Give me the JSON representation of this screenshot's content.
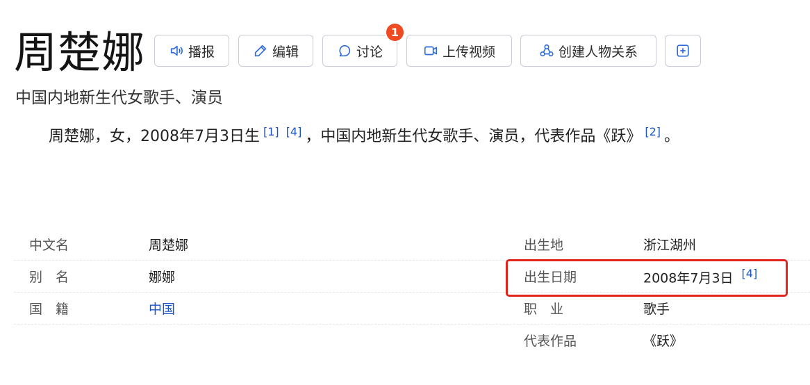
{
  "page": {
    "title": "周楚娜",
    "subtitle": "中国内地新生代女歌手、演员"
  },
  "toolbar": {
    "report_label": "播报",
    "edit_label": "编辑",
    "discuss_label": "讨论",
    "discuss_badge": "1",
    "upload_video_label": "上传视频",
    "relation_label": "创建人物关系"
  },
  "summary": {
    "text_1": "周楚娜，女，2008年7月3日生",
    "ref_1": "[1]",
    "ref_2": "[4]",
    "text_2": "，中国内地新生代女歌手、演员，代表作品《跃》",
    "ref_3": "[2]",
    "text_3": "。"
  },
  "infobox": {
    "left": [
      {
        "label": "中文名",
        "value": "周楚娜"
      },
      {
        "label": "别　名",
        "value": "娜娜"
      },
      {
        "label": "国　籍",
        "value": "中国"
      }
    ],
    "right": [
      {
        "label": "出生地",
        "value": "浙江湖州"
      },
      {
        "label": "出生日期",
        "value": "2008年7月3日",
        "ref": "[4]"
      },
      {
        "label": "职　业",
        "value": "歌手"
      },
      {
        "label": "代表作品",
        "value": "《跃》"
      }
    ]
  },
  "colors": {
    "link": "#1d56c4",
    "badge": "#f04a23",
    "highlight_border": "#e2231a"
  }
}
